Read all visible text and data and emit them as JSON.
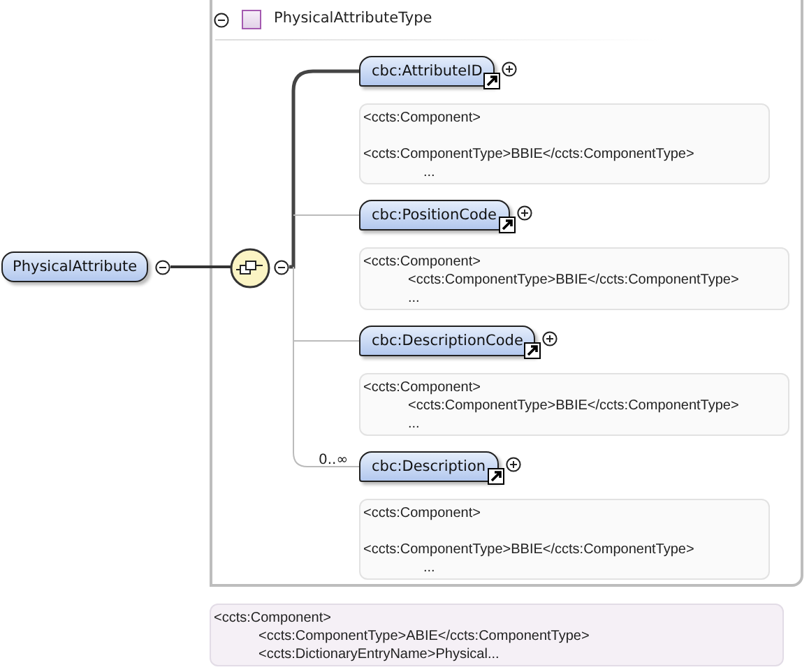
{
  "type": {
    "title": "PhysicalAttributeType",
    "expanded": true
  },
  "root": {
    "name": "PhysicalAttribute",
    "expanded": true
  },
  "compositor": {
    "expanded": true
  },
  "children": [
    {
      "name": "cbc:AttributeID",
      "reference": true,
      "expanded": false,
      "annotation": {
        "wrapped": true,
        "lines": [
          "<ccts:Component>",
          "<ccts:ComponentType>BBIE</ccts:ComponentType>",
          "..."
        ]
      }
    },
    {
      "name": "cbc:PositionCode",
      "reference": true,
      "expanded": false,
      "annotation": {
        "wrapped": false,
        "lines": [
          "<ccts:Component>",
          "<ccts:ComponentType>BBIE</ccts:ComponentType>",
          "..."
        ]
      }
    },
    {
      "name": "cbc:DescriptionCode",
      "reference": true,
      "expanded": false,
      "annotation": {
        "wrapped": false,
        "lines": [
          "<ccts:Component>",
          "<ccts:ComponentType>BBIE</ccts:ComponentType>",
          "..."
        ]
      }
    },
    {
      "name": "cbc:Description",
      "cardinality": "0..∞",
      "reference": true,
      "expanded": false,
      "annotation": {
        "wrapped": true,
        "lines": [
          "<ccts:Component>",
          "<ccts:ComponentType>BBIE</ccts:ComponentType>",
          "..."
        ]
      }
    }
  ],
  "root_annotation": {
    "wrapped": false,
    "lines": [
      "<ccts:Component>",
      "<ccts:ComponentType>ABIE</ccts:ComponentType>",
      "<ccts:DictionaryEntryName>Physical..."
    ]
  }
}
